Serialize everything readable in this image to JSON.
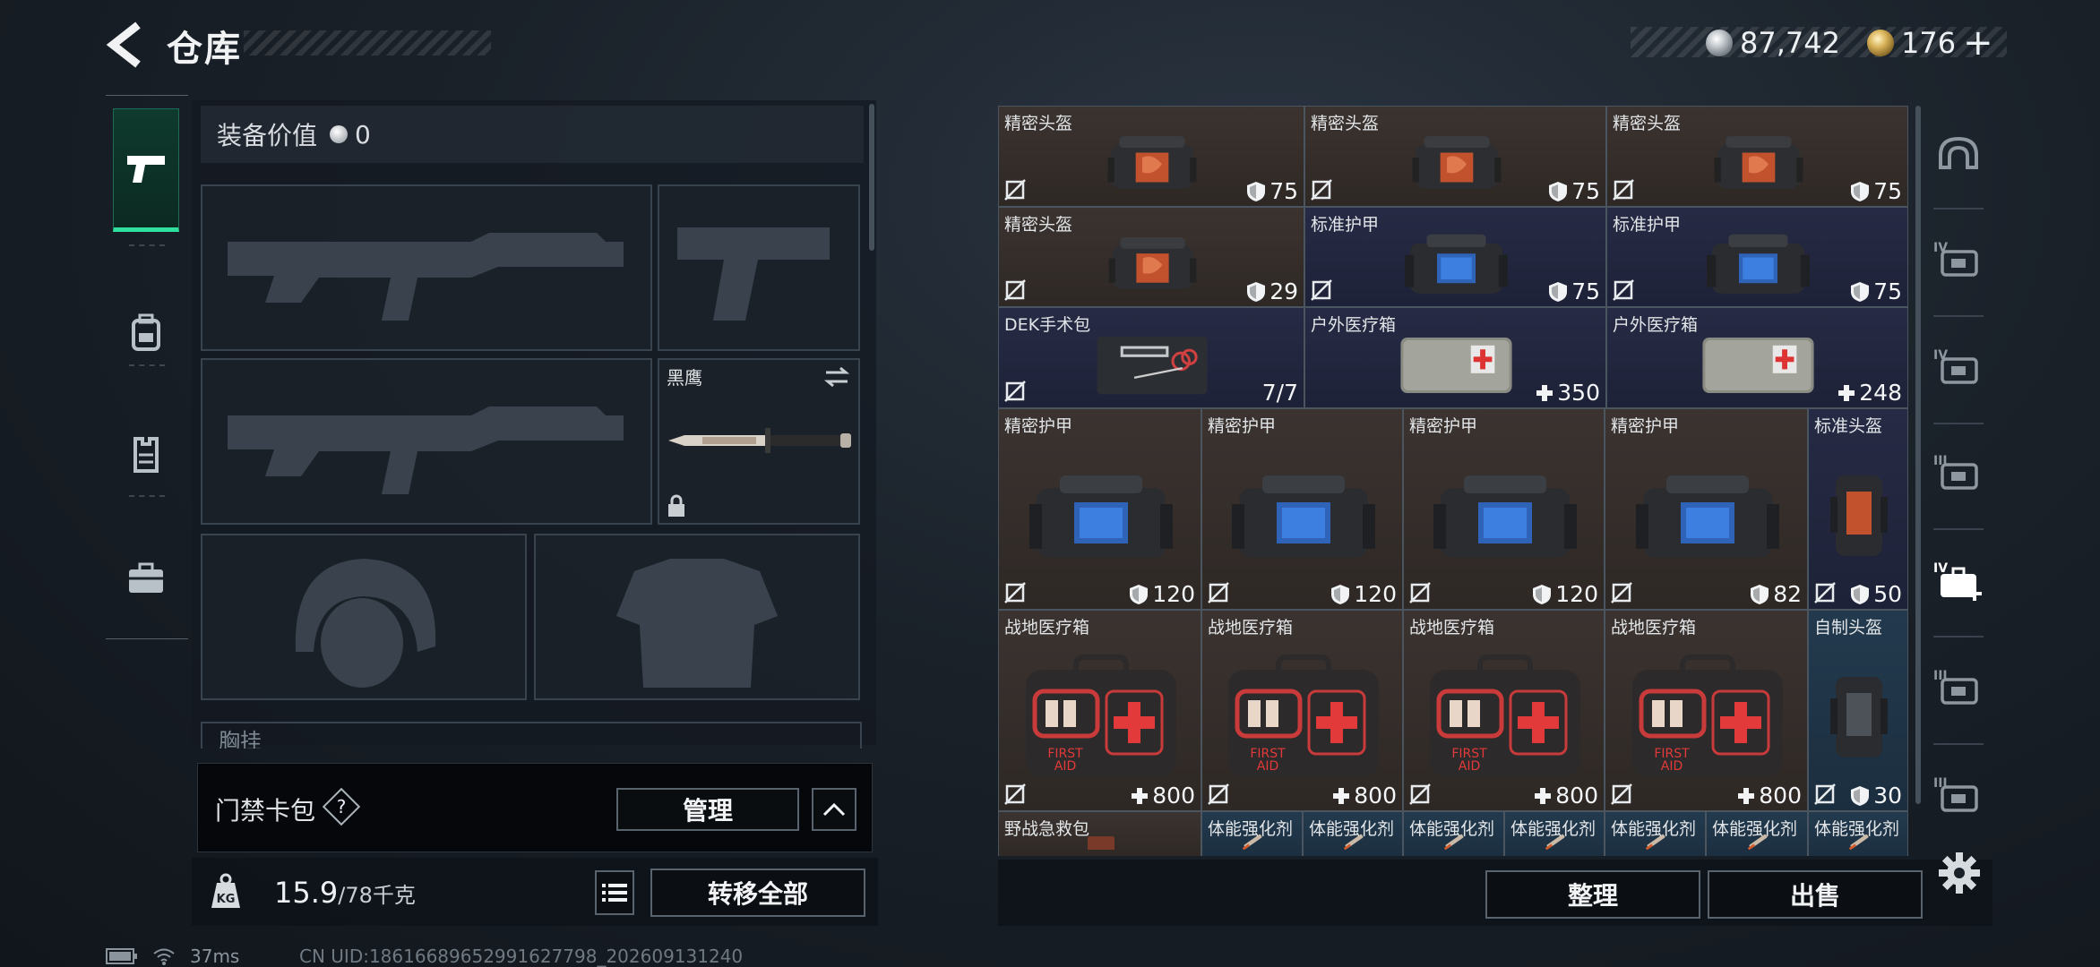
{
  "header": {
    "title": "仓库",
    "currencies": [
      {
        "icon": "silver-coin-icon",
        "value": "87,742"
      },
      {
        "icon": "gold-coin-icon",
        "value": "176"
      }
    ],
    "add_label": "+"
  },
  "equipment": {
    "value_label": "装备价值",
    "value_icon": "silver-coin-icon",
    "value": "0",
    "knife_name": "黑鹰",
    "chest_label": "胸挂",
    "card_bag_label": "门禁卡包",
    "help_mark": "?",
    "manage_label": "管理",
    "weight_value": "15.9",
    "weight_capacity": "/78千克",
    "transfer_all_label": "转移全部"
  },
  "left_tabs": [
    "pistol-icon",
    "backpack-icon",
    "vest-icon",
    "briefcase-icon"
  ],
  "category_tabs": [
    {
      "icon": "helmet-icon",
      "tier": ""
    },
    {
      "icon": "safe-box-icon",
      "tier": "IV"
    },
    {
      "icon": "folder-icon",
      "tier": "IV"
    },
    {
      "icon": "chip-icon",
      "tier": "III"
    },
    {
      "icon": "medkit-icon",
      "tier": "IV"
    },
    {
      "icon": "shield-icon",
      "tier": "III"
    },
    {
      "icon": "tool-icon",
      "tier": "III"
    }
  ],
  "inventory": [
    {
      "name": "精密头盔",
      "value": "75",
      "icon": "shield-icon",
      "bg": "brown"
    },
    {
      "name": "精密头盔",
      "value": "75",
      "icon": "shield-icon",
      "bg": "brown"
    },
    {
      "name": "精密头盔",
      "value": "75",
      "icon": "shield-icon",
      "bg": "brown"
    },
    {
      "name": "精密头盔",
      "value": "29",
      "icon": "shield-icon",
      "bg": "brown"
    },
    {
      "name": "标准护甲",
      "value": "75",
      "icon": "shield-icon",
      "bg": "navy"
    },
    {
      "name": "标准护甲",
      "value": "75",
      "icon": "shield-icon",
      "bg": "navy"
    },
    {
      "name": "DEK手术包",
      "value": "7/7",
      "icon": "",
      "bg": "navy"
    },
    {
      "name": "户外医疗箱",
      "value": "350",
      "icon": "plus-icon",
      "bg": "navy"
    },
    {
      "name": "户外医疗箱",
      "value": "248",
      "icon": "plus-icon",
      "bg": "navy"
    },
    {
      "name": "精密护甲",
      "value": "120",
      "icon": "shield-icon",
      "bg": "brown"
    },
    {
      "name": "精密护甲",
      "value": "120",
      "icon": "shield-icon",
      "bg": "brown"
    },
    {
      "name": "精密护甲",
      "value": "120",
      "icon": "shield-icon",
      "bg": "brown"
    },
    {
      "name": "精密护甲",
      "value": "82",
      "icon": "shield-icon",
      "bg": "brown"
    },
    {
      "name": "标准头盔",
      "value": "50",
      "icon": "shield-icon",
      "bg": "navy"
    },
    {
      "name": "战地医疗箱",
      "value": "800",
      "icon": "plus-icon",
      "bg": "brown"
    },
    {
      "name": "战地医疗箱",
      "value": "800",
      "icon": "plus-icon",
      "bg": "brown"
    },
    {
      "name": "战地医疗箱",
      "value": "800",
      "icon": "plus-icon",
      "bg": "brown"
    },
    {
      "name": "战地医疗箱",
      "value": "800",
      "icon": "plus-icon",
      "bg": "brown"
    },
    {
      "name": "自制头盔",
      "value": "30",
      "icon": "shield-icon",
      "bg": "teal"
    },
    {
      "name": "野战急救包",
      "value": "",
      "icon": "",
      "bg": "brown"
    },
    {
      "name": "体能强化剂",
      "value": "",
      "icon": "",
      "bg": "teal"
    },
    {
      "name": "体能强化剂",
      "value": "",
      "icon": "",
      "bg": "teal"
    },
    {
      "name": "体能强化剂",
      "value": "",
      "icon": "",
      "bg": "teal"
    },
    {
      "name": "体能强化剂",
      "value": "",
      "icon": "",
      "bg": "teal"
    },
    {
      "name": "体能强化剂",
      "value": "",
      "icon": "",
      "bg": "teal"
    },
    {
      "name": "体能强化剂",
      "value": "",
      "icon": "",
      "bg": "teal"
    },
    {
      "name": "体能强化剂",
      "value": "",
      "icon": "",
      "bg": "teal"
    }
  ],
  "actions": {
    "sort_label": "整理",
    "sell_label": "出售"
  },
  "status_bar": {
    "ping": "37ms",
    "uid": "CN UID:18616689652991627798_202609131240"
  },
  "colors": {
    "accent_green": "#2fe0a0",
    "cell_brown": "#3b3330",
    "cell_navy": "#262a44",
    "cell_teal": "#233a4e"
  }
}
